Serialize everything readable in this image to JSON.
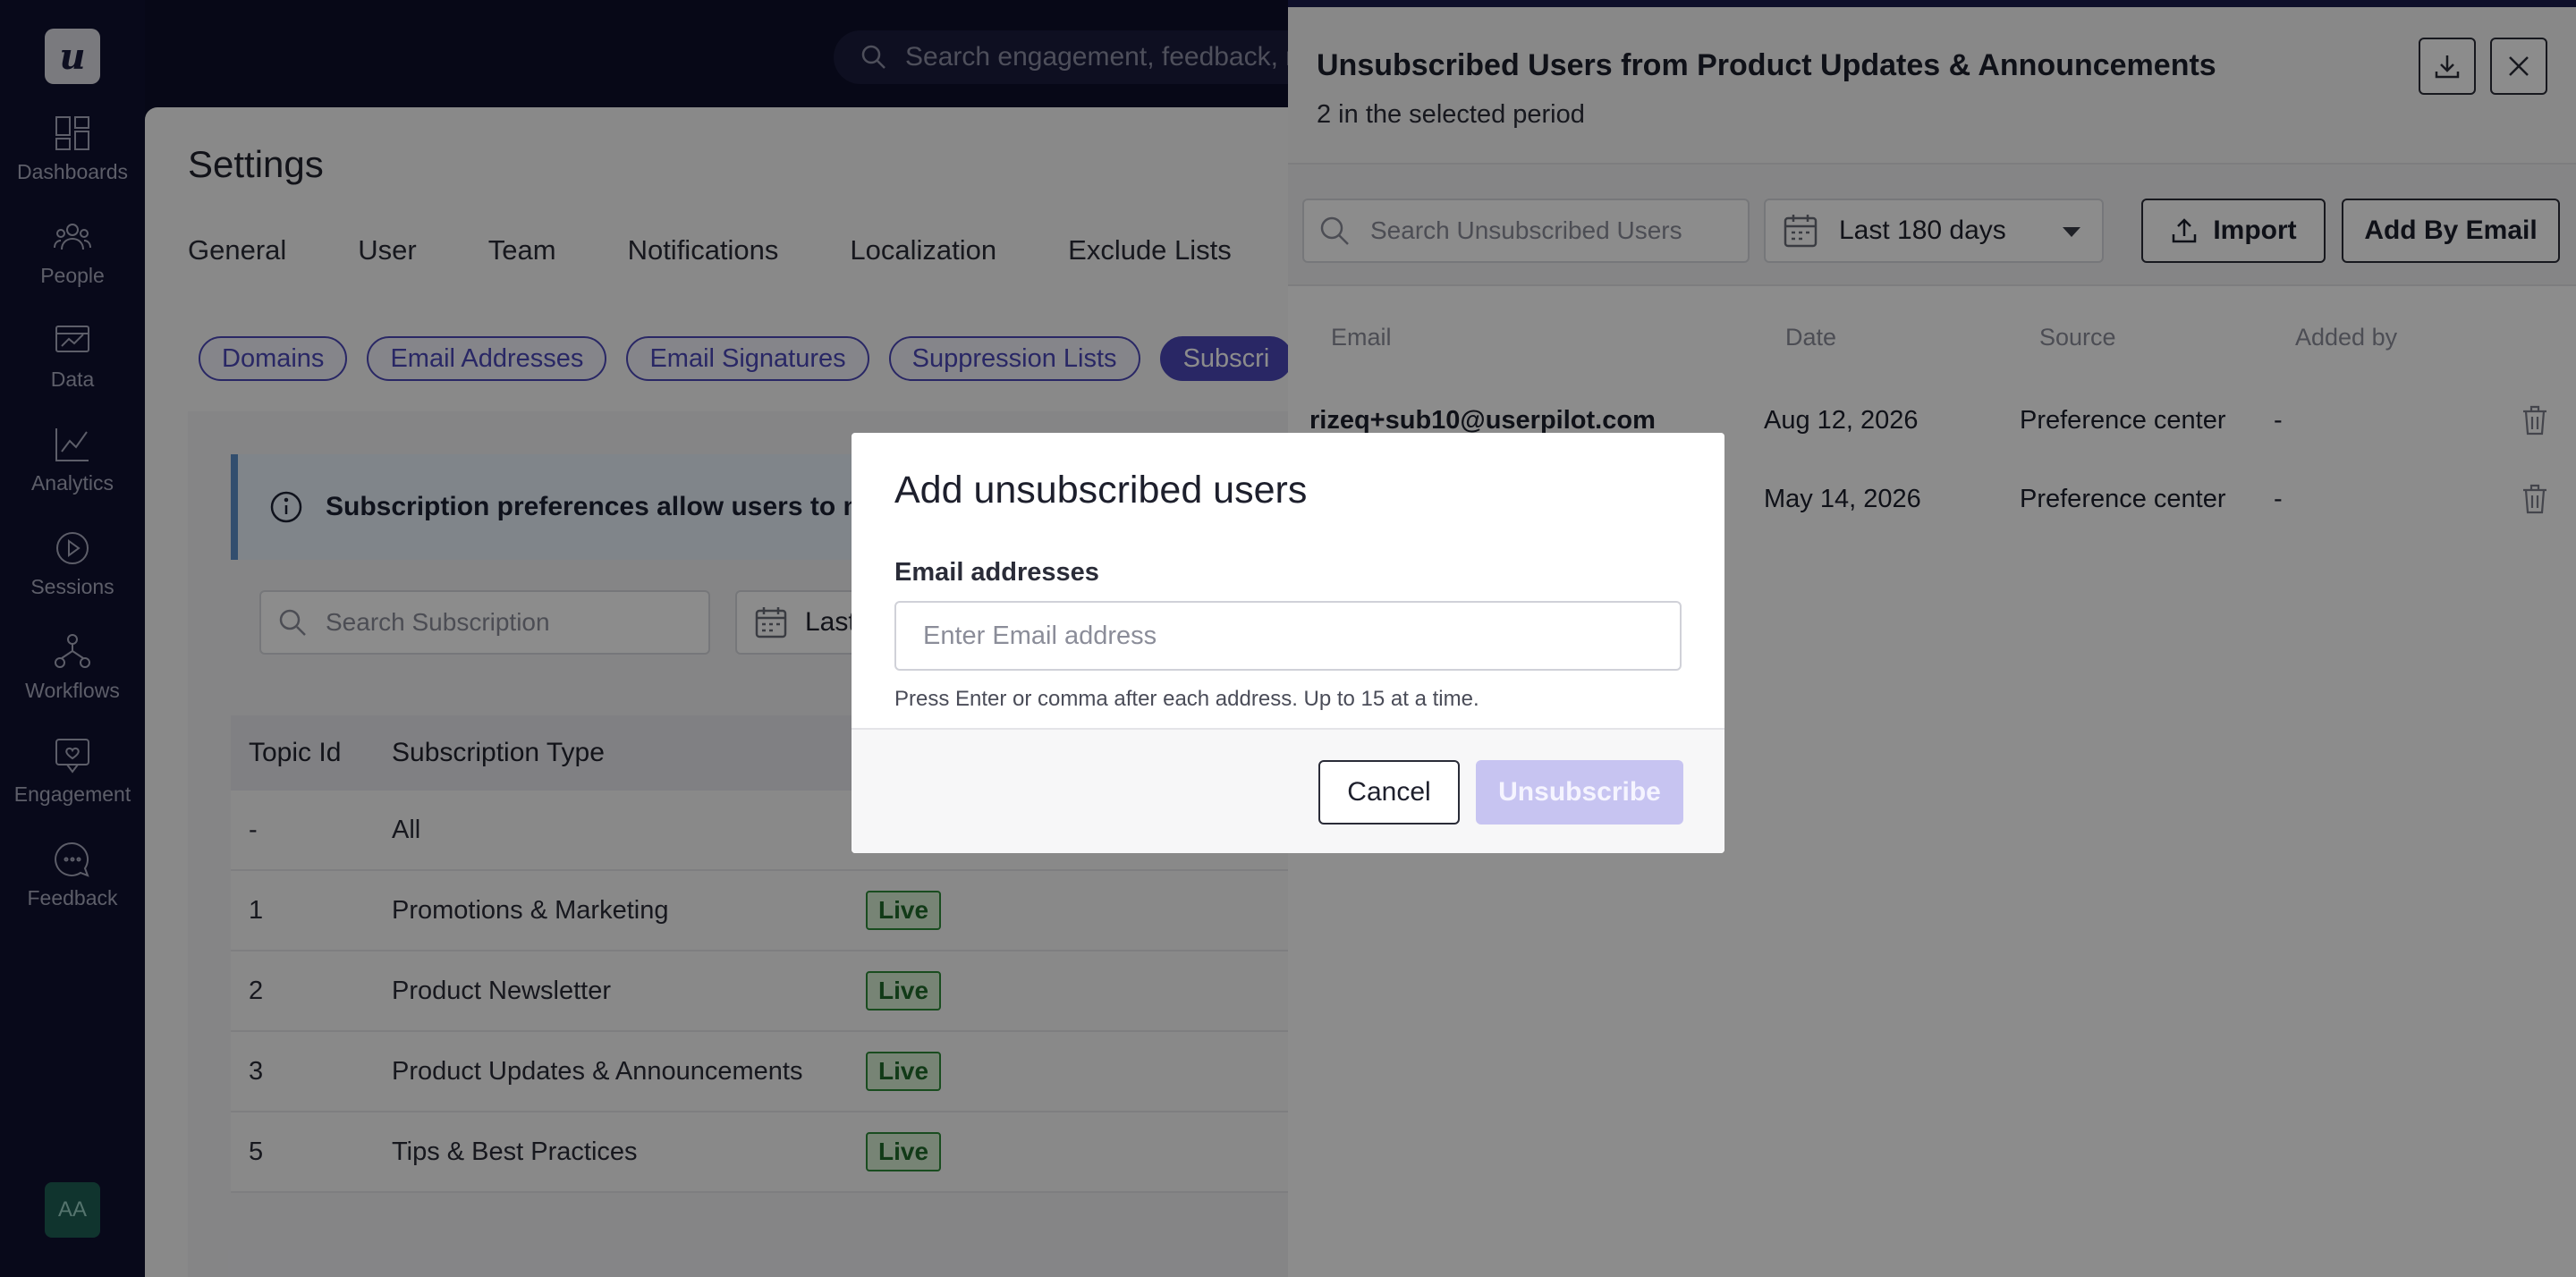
{
  "app": {
    "logo_letter": "u",
    "search_placeholder": "Search engagement, feedback, re",
    "avatar_initials": "AA"
  },
  "sidebar": {
    "items": [
      {
        "label": "Dashboards",
        "icon": "dashboard-icon"
      },
      {
        "label": "People",
        "icon": "people-icon"
      },
      {
        "label": "Data",
        "icon": "data-icon"
      },
      {
        "label": "Analytics",
        "icon": "analytics-icon"
      },
      {
        "label": "Sessions",
        "icon": "play-icon"
      },
      {
        "label": "Workflows",
        "icon": "workflow-icon"
      },
      {
        "label": "Engagement",
        "icon": "engagement-icon"
      },
      {
        "label": "Feedback",
        "icon": "feedback-icon"
      }
    ]
  },
  "settings": {
    "title": "Settings",
    "tabs": [
      "General",
      "User",
      "Team",
      "Notifications",
      "Localization",
      "Exclude Lists"
    ],
    "pills": [
      "Domains",
      "Email Addresses",
      "Email Signatures",
      "Suppression Lists",
      "Subscri"
    ],
    "info_text": "Subscription preferences allow users to ma",
    "search_placeholder": "Search Subscription",
    "date_label": "Last",
    "table": {
      "headers": [
        "Topic Id",
        "Subscription Type"
      ],
      "rows": [
        {
          "id": "-",
          "type": "All",
          "status": ""
        },
        {
          "id": "1",
          "type": "Promotions & Marketing",
          "status": "Live"
        },
        {
          "id": "2",
          "type": "Product Newsletter",
          "status": "Live"
        },
        {
          "id": "3",
          "type": "Product Updates & Announcements",
          "status": "Live"
        },
        {
          "id": "5",
          "type": "Tips & Best Practices",
          "status": "Live"
        }
      ]
    }
  },
  "drawer": {
    "title": "Unsubscribed Users from Product Updates & Announcements",
    "subtitle": "2 in the selected period",
    "search_placeholder": "Search Unsubscribed Users",
    "date_range": "Last 180 days",
    "import_label": "Import",
    "add_by_email_label": "Add By Email",
    "headers": [
      "Email",
      "Date",
      "Source",
      "Added by"
    ],
    "rows": [
      {
        "email": "rizeq+sub10@userpilot.com",
        "date": "Aug 12, 2026",
        "source": "Preference center",
        "added_by": "-"
      },
      {
        "email": "",
        "date": "May 14, 2026",
        "source": "Preference center",
        "added_by": "-"
      }
    ]
  },
  "modal": {
    "title": "Add unsubscribed users",
    "label": "Email addresses",
    "placeholder": "Enter Email address",
    "help": "Press Enter or comma after each address. Up to 15 at a time.",
    "cancel_label": "Cancel",
    "submit_label": "Unsubscribe"
  },
  "colors": {
    "sidebar_bg": "#0f1130",
    "accent": "#4b48b8",
    "live_green": "#2f8b3a",
    "unsubscribe_disabled": "#c7c4f1"
  }
}
